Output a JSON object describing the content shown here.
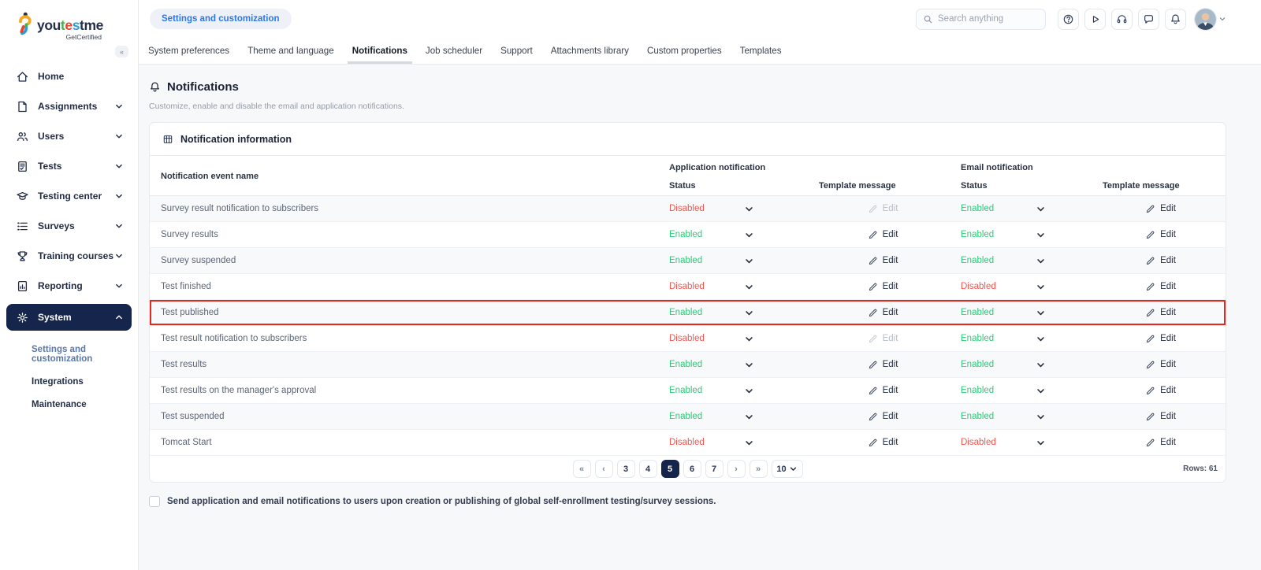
{
  "brand": {
    "wordmark": [
      {
        "text": "you",
        "color": "#232e4a"
      },
      {
        "text": "t",
        "color": "#3eb549"
      },
      {
        "text": "e",
        "color": "#e8432e"
      },
      {
        "text": "s",
        "color": "#2d9cdb"
      },
      {
        "text": "tme",
        "color": "#232e4a"
      }
    ],
    "tagline": "GetCertified",
    "collapse_icon": "«"
  },
  "sidebar": {
    "items": [
      {
        "label": "Home",
        "icon": "home-icon",
        "chevron": false,
        "active": false
      },
      {
        "label": "Assignments",
        "icon": "document-icon",
        "chevron": true,
        "active": false
      },
      {
        "label": "Users",
        "icon": "users-icon",
        "chevron": true,
        "active": false
      },
      {
        "label": "Tests",
        "icon": "test-icon",
        "chevron": true,
        "active": false
      },
      {
        "label": "Testing center",
        "icon": "graduation-cap-icon",
        "chevron": true,
        "active": false
      },
      {
        "label": "Surveys",
        "icon": "list-icon",
        "chevron": true,
        "active": false
      },
      {
        "label": "Training courses",
        "icon": "trophy-icon",
        "chevron": true,
        "active": false
      },
      {
        "label": "Reporting",
        "icon": "report-icon",
        "chevron": true,
        "active": false
      },
      {
        "label": "System",
        "icon": "gear-icon",
        "chevron": true,
        "active": true,
        "expanded": true
      }
    ],
    "subitems": [
      {
        "label": "Settings and customization",
        "active": true
      },
      {
        "label": "Integrations",
        "active": false
      },
      {
        "label": "Maintenance",
        "active": false
      }
    ]
  },
  "header": {
    "breadcrumb": "Settings and customization",
    "search_placeholder": "Search anything",
    "icons": [
      "help-icon",
      "play-icon",
      "headset-icon",
      "chat-icon",
      "bell-icon"
    ]
  },
  "tabs": [
    {
      "label": "System preferences",
      "active": false
    },
    {
      "label": "Theme and language",
      "active": false
    },
    {
      "label": "Notifications",
      "active": true
    },
    {
      "label": "Job scheduler",
      "active": false
    },
    {
      "label": "Support",
      "active": false
    },
    {
      "label": "Attachments library",
      "active": false
    },
    {
      "label": "Custom properties",
      "active": false
    },
    {
      "label": "Templates",
      "active": false
    }
  ],
  "page": {
    "title": "Notifications",
    "subtitle": "Customize, enable and disable the email and application notifications."
  },
  "card": {
    "title": "Notification information"
  },
  "table": {
    "headers": {
      "event_name": "Notification event name",
      "app_group": "Application notification",
      "email_group": "Email notification",
      "status": "Status",
      "template": "Template message"
    },
    "edit_label": "Edit",
    "rows": [
      {
        "name": "Survey result notification to subscribers",
        "app_status": "Disabled",
        "app_edit_enabled": false,
        "email_status": "Enabled",
        "email_edit_enabled": true,
        "highlighted": false
      },
      {
        "name": "Survey results",
        "app_status": "Enabled",
        "app_edit_enabled": true,
        "email_status": "Enabled",
        "email_edit_enabled": true,
        "highlighted": false
      },
      {
        "name": "Survey suspended",
        "app_status": "Enabled",
        "app_edit_enabled": true,
        "email_status": "Enabled",
        "email_edit_enabled": true,
        "highlighted": false
      },
      {
        "name": "Test finished",
        "app_status": "Disabled",
        "app_edit_enabled": true,
        "email_status": "Disabled",
        "email_edit_enabled": true,
        "highlighted": false
      },
      {
        "name": "Test published",
        "app_status": "Enabled",
        "app_edit_enabled": true,
        "email_status": "Enabled",
        "email_edit_enabled": true,
        "highlighted": true
      },
      {
        "name": "Test result notification to subscribers",
        "app_status": "Disabled",
        "app_edit_enabled": false,
        "email_status": "Enabled",
        "email_edit_enabled": true,
        "highlighted": false
      },
      {
        "name": "Test results",
        "app_status": "Enabled",
        "app_edit_enabled": true,
        "email_status": "Enabled",
        "email_edit_enabled": true,
        "highlighted": false
      },
      {
        "name": "Test results on the manager's approval",
        "app_status": "Enabled",
        "app_edit_enabled": true,
        "email_status": "Enabled",
        "email_edit_enabled": true,
        "highlighted": false
      },
      {
        "name": "Test suspended",
        "app_status": "Enabled",
        "app_edit_enabled": true,
        "email_status": "Enabled",
        "email_edit_enabled": true,
        "highlighted": false
      },
      {
        "name": "Tomcat Start",
        "app_status": "Disabled",
        "app_edit_enabled": true,
        "email_status": "Disabled",
        "email_edit_enabled": true,
        "highlighted": false
      }
    ]
  },
  "pagination": {
    "buttons": [
      "«",
      "‹",
      "3",
      "4",
      "5",
      "6",
      "7",
      "›",
      "»"
    ],
    "active_page": "5",
    "page_size": "10",
    "rows_info": "Rows: 61"
  },
  "footer": {
    "checkbox_label": "Send application and email notifications to users upon creation or publishing of global self-enrollment testing/survey sessions.",
    "checkbox_checked": false
  },
  "colors": {
    "enabled": "#2bcd77",
    "disabled": "#f4574f",
    "highlight_border": "#e3281e",
    "accent_blue": "#2e77e8",
    "navy": "#16254c"
  }
}
